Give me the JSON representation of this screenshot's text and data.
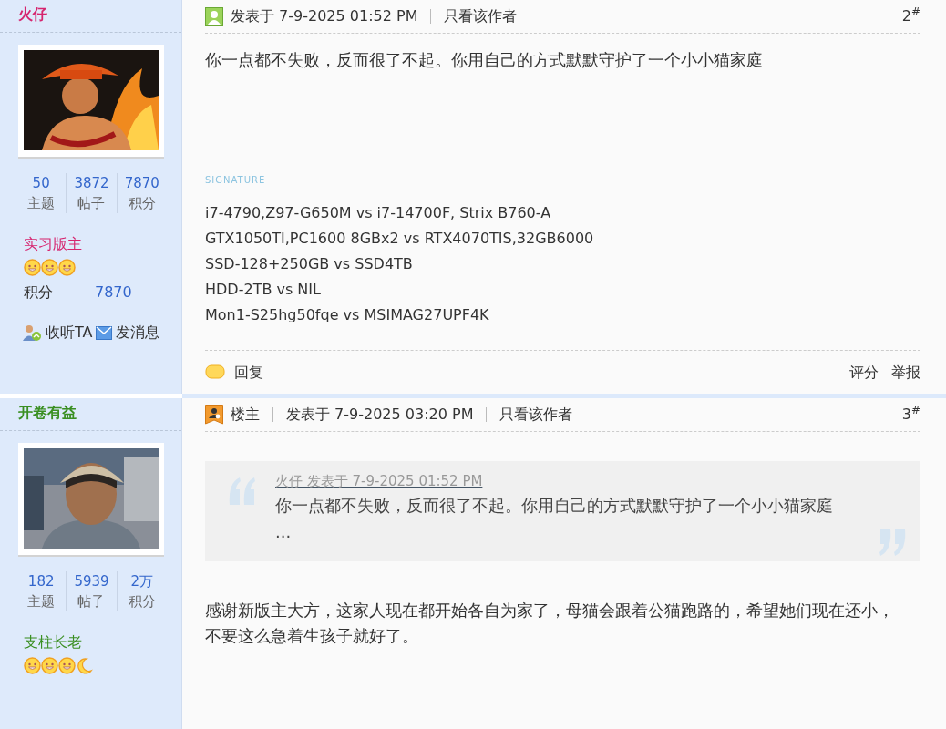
{
  "posts": [
    {
      "author": {
        "name": "火仔",
        "color": "#d6246e",
        "stats": [
          {
            "value": "50",
            "label": "主题"
          },
          {
            "value": "3872",
            "label": "帖子"
          },
          {
            "value": "7870",
            "label": "积分"
          }
        ],
        "group": "实习版主",
        "rank_icons": [
          {
            "kind": "sun"
          },
          {
            "kind": "sun"
          },
          {
            "kind": "sun"
          }
        ],
        "points_label": "积分",
        "points": "7870",
        "actions": [
          {
            "kind": "follow",
            "label": "收听TA"
          },
          {
            "kind": "message",
            "label": "发消息"
          }
        ]
      },
      "header": {
        "posted": "发表于 7-9-2025 01:52 PM",
        "author_only": "只看该作者",
        "floor": "2$^{#}$"
      },
      "body": [
        "你一点都不失败，反而很了不起。你用自己的方式默默守护了一个小小猫家庭"
      ],
      "signature": {
        "label": "SIGNATURE",
        "lines": [
          "i7-4790,Z97-G650M vs i7-14700F, Strix B760-A",
          "GTX1050TI,PC1600 8GBx2 vs RTX4070TIS,32GB6000",
          "SSD-128+250GB vs SSD4TB",
          "HDD-2TB vs NIL",
          "Mon1-S25hg50fqe vs MSIMAG27UPF4K"
        ]
      },
      "footer": {
        "reply": "回复",
        "actions": [
          "评分",
          "举报"
        ]
      }
    },
    {
      "author": {
        "name": "开卷有益",
        "color": "#3a8f22",
        "stats": [
          {
            "value": "182",
            "label": "主题"
          },
          {
            "value": "5939",
            "label": "帖子"
          },
          {
            "value": "2万",
            "label": "积分"
          }
        ],
        "group": "支柱长老",
        "rank_icons": [
          {
            "kind": "sun"
          },
          {
            "kind": "sun"
          },
          {
            "kind": "sun"
          },
          {
            "kind": "moon"
          }
        ]
      },
      "header": {
        "op_label": "楼主",
        "posted": "发表于 7-9-2025 03:20 PM",
        "author_only": "只看该作者",
        "floor": "3$^{#}$"
      },
      "quote": {
        "source": "火仔 发表于 7-9-2025 01:52 PM",
        "text": "你一点都不失败，反而很了不起。你用自己的方式默默守护了一个小小猫家庭 ..."
      },
      "body": [
        "感谢新版主大方，这家人现在都开始各自为家了，母猫会跟着公猫跑路的，希望她们现在还小，不要这么急着生孩子就好了。"
      ]
    }
  ]
}
